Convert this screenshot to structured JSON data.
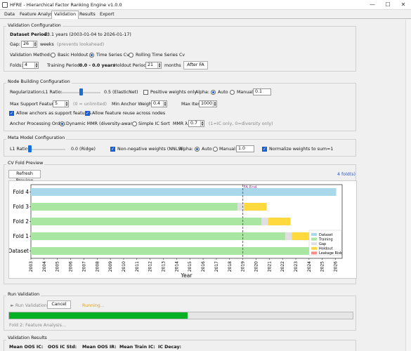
{
  "window": {
    "title": "HFRE - Hierarchical Factor Ranking Engine v1.0.0",
    "minimize": "—",
    "maximize": "☐",
    "close": "✕"
  },
  "tabs": [
    "Data",
    "Feature Analysis",
    "Validation",
    "Results",
    "Export"
  ],
  "validation_config": {
    "title": "Validation Configuration",
    "dataset_period_label": "Dataset Period:",
    "dataset_period_value": "23.1 years (2003-01-04 to 2026-01-17)",
    "gap_label": "Gap:",
    "gap_value": "26",
    "gap_unit": "weeks",
    "gap_hint": "(prevents lookahead)",
    "method_label": "Validation Method:",
    "methods": [
      "Basic Holdout",
      "Time Series Cv",
      "Rolling Time Series Cv"
    ],
    "selected_method": 1,
    "folds_label": "Folds:",
    "folds_value": "4",
    "training_period_label": "Training Period:",
    "training_period_value": "0.0 - 0.0 years",
    "holdout_label": "Holdout Period:",
    "holdout_value": "21",
    "holdout_unit": "months",
    "after_fa_button": "After FA"
  },
  "node_config": {
    "title": "Node Building Configuration",
    "regularization_label": "Regularization:",
    "l1_label": "L1 Ratio:",
    "l1_value_text": "0.5 (ElasticNet)",
    "l1_fraction": 0.5,
    "positive_weights_label": "Positive weights only",
    "alpha_label": "Alpha:",
    "alpha_auto": "Auto",
    "alpha_manual": "Manual:",
    "alpha_value": "0.1",
    "max_support_label": "Max Support Features:",
    "max_support_value": "5",
    "max_support_hint": "(0 = unlimited)",
    "min_anchor_label": "Min Anchor Weight:",
    "min_anchor_value": "0.4",
    "max_iter_label": "Max Iter:",
    "max_iter_value": "1000",
    "allow_anchors_label": "Allow anchors as support features",
    "allow_reuse_label": "Allow feature reuse across nodes",
    "anchor_order_label": "Anchor Processing Order:",
    "order_dynamic": "Dynamic MMR (diversity-aware)",
    "order_simple": "Simple IC Sort",
    "mmr_label": "MMR λ:",
    "mmr_value": "0.7",
    "mmr_hint": "(1=IC only, 0=diversity only)"
  },
  "meta_config": {
    "title": "Meta Model Configuration",
    "l1_label": "L1 Ratio:",
    "l1_value_text": "0.0 (Ridge)",
    "l1_fraction": 0.0,
    "nonneg_label": "Non-negative weights (NNLS)",
    "alpha_label": "Alpha:",
    "alpha_auto": "Auto",
    "alpha_manual": "Manual:",
    "alpha_value": "1.0",
    "normalize_label": "Normalize weights to sum=1"
  },
  "cv_preview": {
    "title": "CV Fold Preview",
    "refresh_button": "Refresh Preview",
    "fold_count": "4 fold(s)"
  },
  "chart_data": {
    "type": "bar",
    "orientation": "horizontal-timeline",
    "xlabel": "Year",
    "x_ticks": [
      "2003",
      "2004",
      "2005",
      "2006",
      "2007",
      "2008",
      "2009",
      "2010",
      "2011",
      "2012",
      "2013",
      "2014",
      "2015",
      "2016",
      "2017",
      "2018",
      "2019",
      "2020",
      "2021",
      "2022",
      "2023",
      "2024",
      "2025",
      "2026"
    ],
    "xlim": [
      2003,
      2026.5
    ],
    "categories": [
      "Dataset",
      "Fold 1",
      "Fold 2",
      "Fold 3",
      "Fold 4"
    ],
    "fa_end": {
      "label": "FA End",
      "x": 2019.0
    },
    "legend": [
      "Dataset",
      "Training",
      "Gap",
      "Holdout",
      "Leakage Risk"
    ],
    "legend_position": "lower-right",
    "colors": {
      "Dataset": "#a8d8ea",
      "Training": "#a8e6a1",
      "Gap": "#e0e0e0",
      "Holdout": "#ffd93d",
      "Leakage Risk": "#ff8a8a",
      "FA End": "#9b3b9b"
    },
    "series": [
      {
        "category": "Dataset",
        "segments": [
          {
            "kind": "Training",
            "start": 2003.0,
            "end": 2024.4
          },
          {
            "kind": "Gap",
            "start": 2024.4,
            "end": 2024.9
          },
          {
            "kind": "Holdout",
            "start": 2024.9,
            "end": 2026.05
          }
        ]
      },
      {
        "category": "Fold 1",
        "segments": [
          {
            "kind": "Training",
            "start": 2003.0,
            "end": 2022.2
          },
          {
            "kind": "Gap",
            "start": 2022.2,
            "end": 2022.7
          },
          {
            "kind": "Holdout",
            "start": 2022.7,
            "end": 2024.4
          }
        ]
      },
      {
        "category": "Fold 2",
        "segments": [
          {
            "kind": "Training",
            "start": 2003.0,
            "end": 2020.4
          },
          {
            "kind": "Gap",
            "start": 2020.4,
            "end": 2020.9
          },
          {
            "kind": "Holdout",
            "start": 2020.9,
            "end": 2022.6
          }
        ]
      },
      {
        "category": "Fold 3",
        "segments": [
          {
            "kind": "Training",
            "start": 2003.0,
            "end": 2018.6
          },
          {
            "kind": "Gap",
            "start": 2018.6,
            "end": 2019.1
          },
          {
            "kind": "Holdout",
            "start": 2019.1,
            "end": 2020.8
          }
        ]
      },
      {
        "category": "Fold 4",
        "segments": [
          {
            "kind": "Dataset",
            "start": 2003.0,
            "end": 2026.05
          }
        ]
      }
    ]
  },
  "run_validation": {
    "title": "Run Validation",
    "run_button": "► Run Validation",
    "cancel_button": "Cancel",
    "status": "Running...",
    "progress": 0.52,
    "status_detail": "Fold 2: Feature Analysis..."
  },
  "results": {
    "title": "Validation Results",
    "metrics": [
      "Mean OOS IC:",
      "OOS IC Std:",
      "Mean OOS IR:",
      "Mean Train IC:",
      "IC Decay:"
    ]
  }
}
